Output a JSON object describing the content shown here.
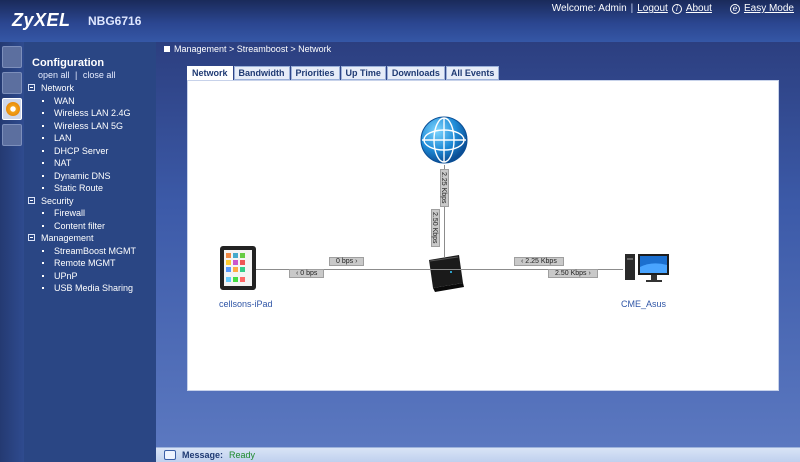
{
  "header": {
    "brand": "ZyXEL",
    "model": "NBG6716",
    "welcome": "Welcome: Admin",
    "logout": "Logout",
    "about": "About",
    "easy_mode": "Easy Mode"
  },
  "nav": {
    "title": "Configuration",
    "open_all": "open all",
    "close_all": "close all",
    "groups": [
      {
        "label": "Network",
        "items": [
          "WAN",
          "Wireless LAN 2.4G",
          "Wireless LAN 5G",
          "LAN",
          "DHCP Server",
          "NAT",
          "Dynamic DNS",
          "Static Route"
        ]
      },
      {
        "label": "Security",
        "items": [
          "Firewall",
          "Content filter"
        ]
      },
      {
        "label": "Management",
        "items": [
          "StreamBoost MGMT",
          "Remote MGMT",
          "UPnP",
          "USB Media Sharing"
        ]
      }
    ]
  },
  "breadcrumb": "Management > Streamboost > Network",
  "tabs": [
    "Network",
    "Bandwidth",
    "Priorities",
    "Up Time",
    "Downloads",
    "All Events"
  ],
  "active_tab": "Network",
  "map": {
    "left_device": "cellsons-iPad",
    "right_device": "CME_Asus",
    "left_up": "0 bps",
    "left_down": "0 bps",
    "right_in": "2.25 Kbps",
    "right_out": "2.50 Kbps",
    "internet_down": "2.25 Kbps",
    "internet_up": "2.50 Kbps"
  },
  "footer": {
    "label": "Message:",
    "value": "Ready"
  },
  "colors": {
    "header": "#2b4690",
    "nav": "#2a4684",
    "accent": "#2f55a6",
    "status_ok": "#1d8a2c"
  }
}
